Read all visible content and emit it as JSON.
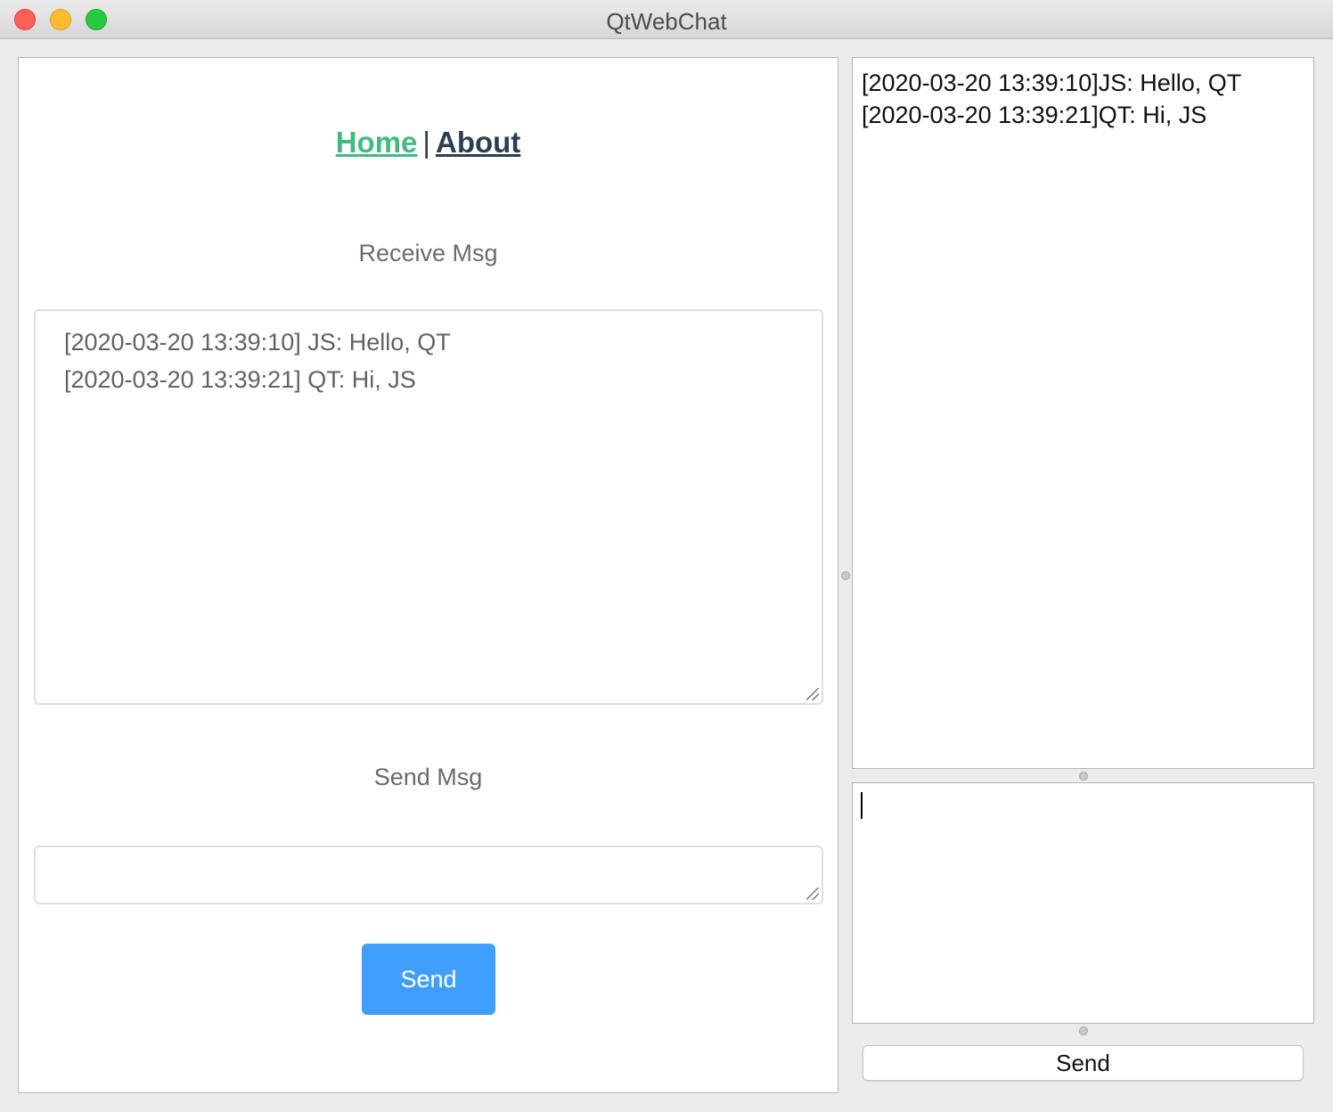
{
  "window": {
    "title": "QtWebChat"
  },
  "web": {
    "nav": {
      "home": "Home",
      "separator": "|",
      "about": "About"
    },
    "receive_label": "Receive Msg",
    "receive_messages": [
      "[2020-03-20 13:39:10] JS: Hello, QT",
      "[2020-03-20 13:39:21] QT: Hi, JS"
    ],
    "send_label": "Send Msg",
    "send_input_value": "",
    "send_button": "Send"
  },
  "qt": {
    "log_lines": [
      "[2020-03-20 13:39:10]JS: Hello, QT",
      "[2020-03-20 13:39:21]QT: Hi, JS"
    ],
    "input_value": "",
    "send_button": "Send"
  },
  "colors": {
    "home_link": "#42b983",
    "about_link": "#2c3e50",
    "web_send_button": "#409eff"
  }
}
